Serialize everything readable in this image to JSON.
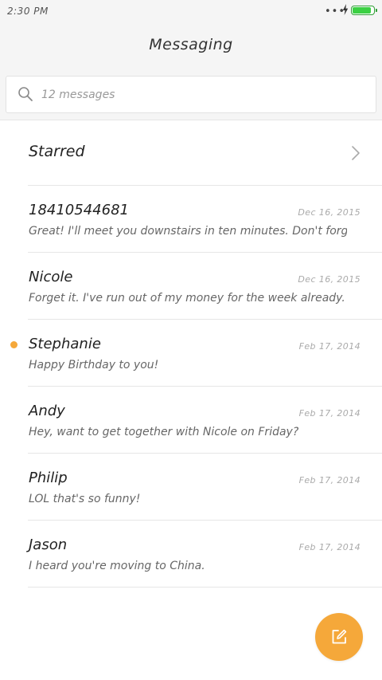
{
  "status_bar": {
    "time": "2:30 PM",
    "dots": "•••",
    "battery_level": 0.95
  },
  "header": {
    "title": "Messaging"
  },
  "search": {
    "placeholder": "12 messages"
  },
  "starred": {
    "label": "Starred"
  },
  "conversations": [
    {
      "name": "18410544681",
      "date": "Dec 16, 2015",
      "preview": "Great! I'll meet you downstairs in ten minutes. Don't forge",
      "unread": false
    },
    {
      "name": "Nicole",
      "date": "Dec 16, 2015",
      "preview": "Forget it. I've run out of my money for the week already.",
      "unread": false
    },
    {
      "name": "Stephanie",
      "date": "Feb 17, 2014",
      "preview": "Happy Birthday to you!",
      "unread": true
    },
    {
      "name": "Andy",
      "date": "Feb 17, 2014",
      "preview": "Hey, want to get together with Nicole on Friday?",
      "unread": false
    },
    {
      "name": "Philip",
      "date": "Feb 17, 2014",
      "preview": "LOL that's so funny!",
      "unread": false
    },
    {
      "name": "Jason",
      "date": "Feb 17, 2014",
      "preview": "I heard you're moving to China.",
      "unread": false
    }
  ],
  "icons": {
    "search": "search-icon",
    "chevron": "chevron-right-icon",
    "compose": "compose-icon",
    "charging": "charging-bolt-icon",
    "battery": "battery-icon"
  },
  "colors": {
    "accent": "#f5a83a",
    "battery": "#3bd043",
    "unread_dot": "#f5a83a"
  }
}
